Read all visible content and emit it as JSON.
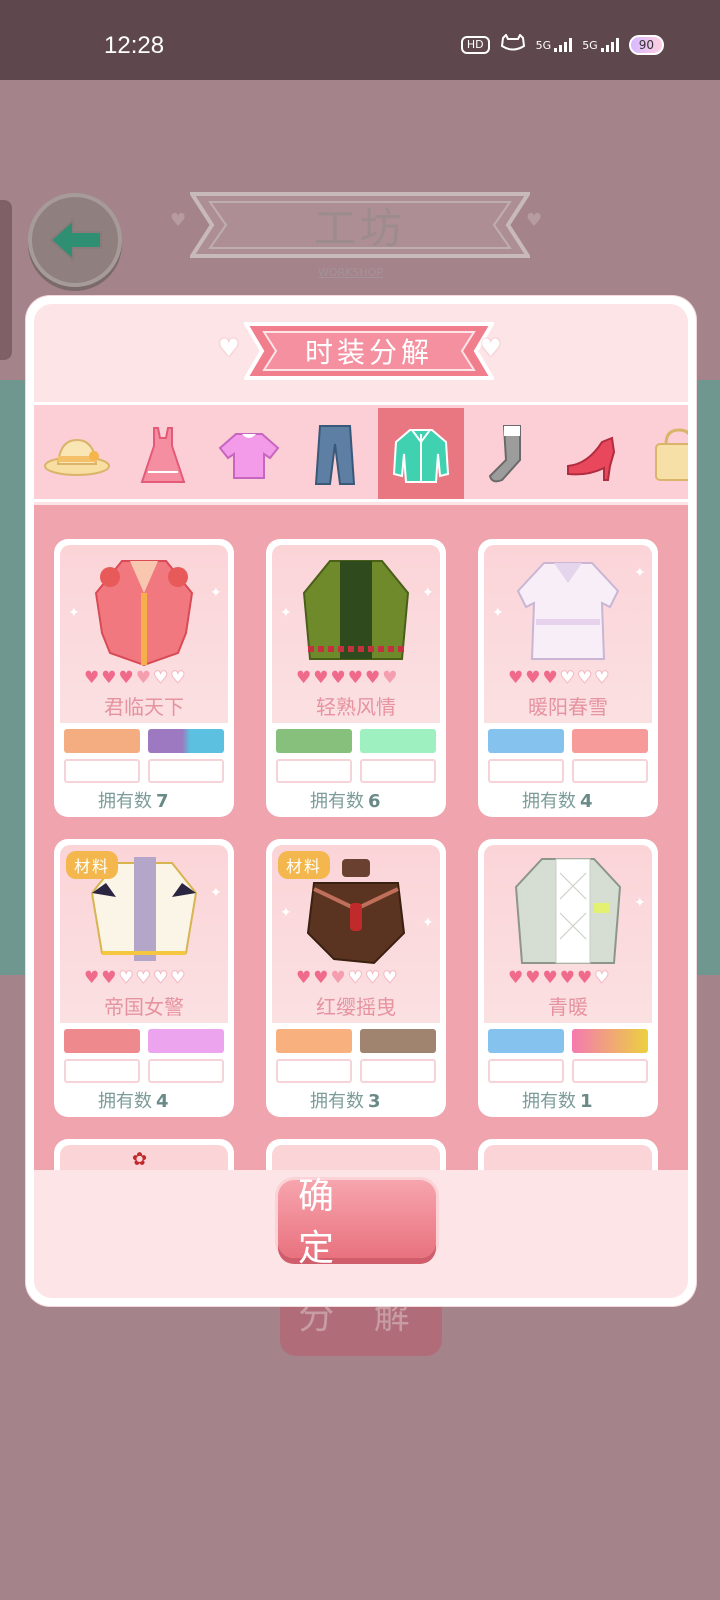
{
  "status_bar": {
    "time": "12:28",
    "hd_chip": "HD",
    "net_1": "5G",
    "net_2": "5G",
    "battery": "90"
  },
  "background": {
    "title": "工坊",
    "subtitle": "WORKSHOP",
    "bottom_button": "分 解",
    "back_icon": "arrow-left-icon"
  },
  "modal": {
    "title": "时装分解",
    "categories": [
      {
        "name": "hat-icon",
        "active": false
      },
      {
        "name": "dress-icon",
        "active": false
      },
      {
        "name": "top-icon",
        "active": false
      },
      {
        "name": "pants-icon",
        "active": false
      },
      {
        "name": "coat-icon",
        "active": true
      },
      {
        "name": "socks-icon",
        "active": false
      },
      {
        "name": "shoe-icon",
        "active": false
      },
      {
        "name": "bag-icon",
        "active": false
      }
    ],
    "owned_label": "拥有数",
    "items": [
      {
        "name": "君临天下",
        "owned": "7",
        "hearts": 3.5,
        "tag": "",
        "colors": [
          "#f4ad80",
          "#9c79c0|#5cc0e0"
        ]
      },
      {
        "name": "轻熟风情",
        "owned": "6",
        "hearts": 5.5,
        "tag": "",
        "colors": [
          "#86c07c",
          "#9ef0c0"
        ]
      },
      {
        "name": "暖阳春雪",
        "owned": "4",
        "hearts": 3,
        "tag": "",
        "colors": [
          "#86c2ee",
          "#f79a9a"
        ]
      },
      {
        "name": "帝国女警",
        "owned": "4",
        "hearts": 2,
        "tag": "材料",
        "colors": [
          "#ee8a8e",
          "#eca4ee"
        ]
      },
      {
        "name": "红缨摇曳",
        "owned": "3",
        "hearts": 2.5,
        "tag": "材料",
        "colors": [
          "#f7b07e",
          "#a08470"
        ]
      },
      {
        "name": "青暖",
        "owned": "1",
        "hearts": 5,
        "tag": "",
        "colors": [
          "#86c2ee",
          "#f47ab0|#ecd040"
        ]
      }
    ],
    "confirm_label": "确 定"
  }
}
